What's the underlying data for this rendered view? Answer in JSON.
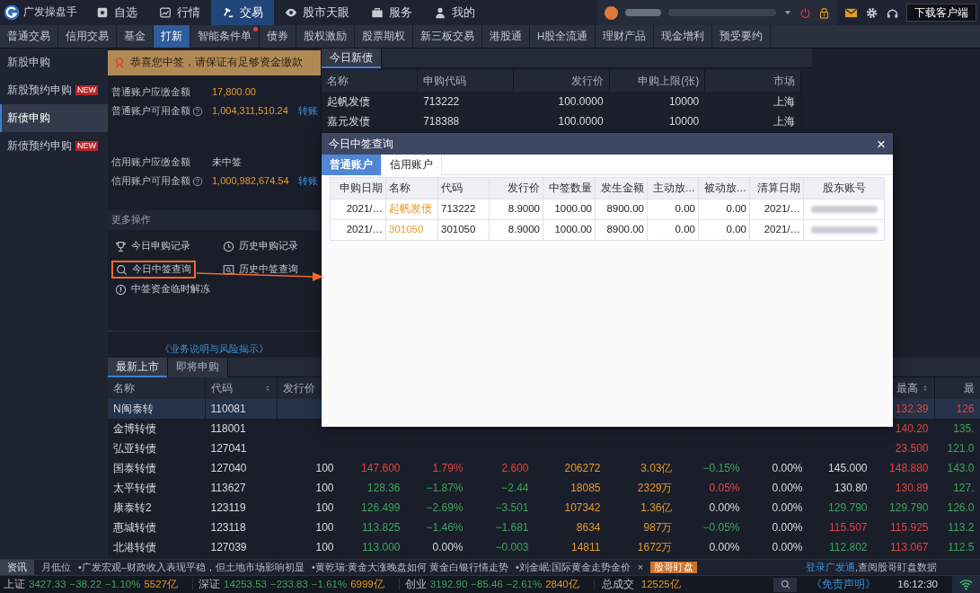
{
  "top_nav": {
    "logo": "广发操盘手",
    "items": [
      {
        "label": "自选",
        "selected": false
      },
      {
        "label": "行情",
        "selected": false
      },
      {
        "label": "交易",
        "selected": true
      },
      {
        "label": "股市天眼",
        "selected": false
      },
      {
        "label": "服务",
        "selected": false
      },
      {
        "label": "我的",
        "selected": false
      }
    ],
    "download": "下载客户端"
  },
  "sub_nav": [
    {
      "label": "普通交易",
      "selected": false
    },
    {
      "label": "信用交易",
      "selected": false
    },
    {
      "label": "基金",
      "selected": false
    },
    {
      "label": "打新",
      "selected": true
    },
    {
      "label": "智能条件单",
      "selected": false,
      "dot": true
    },
    {
      "label": "债券",
      "selected": false
    },
    {
      "label": "股权激励",
      "selected": false
    },
    {
      "label": "股票期权",
      "selected": false
    },
    {
      "label": "新三板交易",
      "selected": false
    },
    {
      "label": "港股通",
      "selected": false
    },
    {
      "label": "H股全流通",
      "selected": false
    },
    {
      "label": "理财产品",
      "selected": false
    },
    {
      "label": "现金增利",
      "selected": false
    },
    {
      "label": "预受要约",
      "selected": false
    }
  ],
  "sidebar": {
    "items": [
      {
        "label": "新股申购",
        "selected": false
      },
      {
        "label": "新股预约申购",
        "selected": false,
        "badge": "NEW"
      },
      {
        "label": "新债申购",
        "selected": true
      },
      {
        "label": "新债预约申购",
        "selected": false,
        "badge": "NEW"
      }
    ]
  },
  "notice": "恭喜您中签，请保证有足够资金缴款",
  "accounts": [
    {
      "rows": [
        {
          "label": "普通账户应缴金额",
          "value": "17,800.00",
          "color": "#e39a2c"
        },
        {
          "label": "普通账户可用金额",
          "help": true,
          "value": "1,004,311,510.24",
          "color": "#e39a2c",
          "link": "转账"
        }
      ]
    },
    {
      "rows": [
        {
          "label": "信用账户应缴金额",
          "value": "未中签"
        },
        {
          "label": "信用账户可用金额",
          "help": true,
          "value": "1,000,982,674.54",
          "color": "#e39a2c",
          "link": "转账"
        }
      ]
    }
  ],
  "more_actions": {
    "title": "更多操作",
    "actions": [
      {
        "label": "今日申购记录",
        "highlighted": false
      },
      {
        "label": "历史申购记录",
        "highlighted": false
      },
      {
        "label": "今日中签查询",
        "highlighted": true
      },
      {
        "label": "历史中签查询",
        "highlighted": false
      },
      {
        "label": "中签资金临时解冻",
        "highlighted": false
      }
    ]
  },
  "risk_link": "《业务说明与风险揭示》",
  "new_bonds": {
    "tab": "今日新债",
    "columns": [
      "名称",
      "申购代码",
      "发行价",
      "申购上限(张)",
      "市场"
    ],
    "rows": [
      [
        "起帆发债",
        "713222",
        "100.0000",
        "10000",
        "上海"
      ],
      [
        "嘉元发债",
        "718388",
        "100.0000",
        "10000",
        "上海"
      ]
    ]
  },
  "dialog": {
    "title": "今日中签查询",
    "close": "×",
    "tabs": [
      {
        "label": "普通账户",
        "selected": true
      },
      {
        "label": "信用账户",
        "selected": false
      }
    ],
    "columns": [
      "申购日期",
      "名称",
      "代码",
      "发行价",
      "中签数量",
      "发生金额",
      "主动放…",
      "被动放…",
      "清算日期",
      "股东账号"
    ],
    "rows": [
      {
        "cells": [
          "2021/…",
          "起帆发债",
          "713222",
          "8.9000",
          "1000.00",
          "8900.00",
          "0.00",
          "0.00",
          "2021/…"
        ],
        "account_hidden": true
      },
      {
        "cells": [
          "2021/…",
          "301050",
          "301050",
          "8.9000",
          "1000.00",
          "8900.00",
          "0.00",
          "0.00",
          "2021/…"
        ],
        "account_hidden": true
      }
    ]
  },
  "listing": {
    "tabs": [
      {
        "label": "最新上市",
        "selected": true
      },
      {
        "label": "即将申购",
        "selected": false
      }
    ],
    "columns": [
      {
        "label": "名称"
      },
      {
        "label": "代码",
        "sortable": true
      },
      {
        "label": "发行价"
      },
      {},
      {},
      {},
      {},
      {},
      {},
      {},
      {},
      {
        "label": "最高",
        "sortable": true
      },
      {
        "label": "最"
      }
    ],
    "rows": [
      {
        "selected": true,
        "cells": [
          {
            "text": "N闽泰转"
          },
          {
            "text": "110081"
          },
          null,
          null,
          null,
          null,
          null,
          null,
          null,
          null,
          null,
          {
            "text": "132.39",
            "color": "#e2433f"
          },
          {
            "text": "126",
            "color": "#e2433f"
          }
        ]
      },
      {
        "selected": false,
        "cells": [
          {
            "text": "金博转债"
          },
          {
            "text": "118001"
          },
          null,
          null,
          null,
          null,
          null,
          null,
          null,
          null,
          null,
          {
            "text": "140.20",
            "color": "#e2433f"
          },
          {
            "text": "135.",
            "color": "#3ba55c"
          }
        ]
      },
      {
        "selected": false,
        "cells": [
          {
            "text": "弘亚转债"
          },
          {
            "text": "127041"
          },
          null,
          null,
          null,
          null,
          null,
          null,
          null,
          null,
          null,
          {
            "text": "23.500",
            "color": "#e2433f"
          },
          {
            "text": "121.0",
            "color": "#3ba55c"
          }
        ]
      },
      {
        "selected": false,
        "cells": [
          {
            "text": "国泰转债"
          },
          {
            "text": "127040"
          },
          {
            "text": "100",
            "color": "#d9dbe0"
          },
          {
            "text": "147.600",
            "color": "#e2433f"
          },
          {
            "text": "1.79%",
            "color": "#e2433f"
          },
          {
            "text": "2.600",
            "color": "#e2433f"
          },
          {
            "text": "206272",
            "color": "#e39a2c"
          },
          {
            "text": "3.03亿",
            "color": "#e39a2c"
          },
          {
            "text": "−0.15%",
            "color": "#3ba55c"
          },
          {
            "text": "0.00%",
            "color": "#d9dbe0"
          },
          {
            "text": "145.000",
            "color": "#d9dbe0"
          },
          {
            "text": "148.880",
            "color": "#e2433f"
          },
          {
            "text": "143.0",
            "color": "#3ba55c"
          }
        ]
      },
      {
        "selected": false,
        "cells": [
          {
            "text": "太平转债"
          },
          {
            "text": "113627"
          },
          {
            "text": "100",
            "color": "#d9dbe0"
          },
          {
            "text": "128.36",
            "color": "#3ba55c"
          },
          {
            "text": "−1.87%",
            "color": "#3ba55c"
          },
          {
            "text": "−2.44",
            "color": "#3ba55c"
          },
          {
            "text": "18085",
            "color": "#e39a2c"
          },
          {
            "text": "2329万",
            "color": "#e39a2c"
          },
          {
            "text": "0.05%",
            "color": "#e2433f"
          },
          {
            "text": "0.00%",
            "color": "#d9dbe0"
          },
          {
            "text": "130.80",
            "color": "#d9dbe0"
          },
          {
            "text": "130.89",
            "color": "#e2433f"
          },
          {
            "text": "127.",
            "color": "#3ba55c"
          }
        ]
      },
      {
        "selected": false,
        "cells": [
          {
            "text": "康泰转2"
          },
          {
            "text": "123119"
          },
          {
            "text": "100",
            "color": "#d9dbe0"
          },
          {
            "text": "126.499",
            "color": "#3ba55c"
          },
          {
            "text": "−2.69%",
            "color": "#3ba55c"
          },
          {
            "text": "−3.501",
            "color": "#3ba55c"
          },
          {
            "text": "107342",
            "color": "#e39a2c"
          },
          {
            "text": "1.36亿",
            "color": "#e39a2c"
          },
          {
            "text": "0.00%",
            "color": "#d9dbe0"
          },
          {
            "text": "0.00%",
            "color": "#d9dbe0"
          },
          {
            "text": "129.790",
            "color": "#3ba55c"
          },
          {
            "text": "129.790",
            "color": "#3ba55c"
          },
          {
            "text": "126.0",
            "color": "#3ba55c"
          }
        ]
      },
      {
        "selected": false,
        "cells": [
          {
            "text": "惠城转债"
          },
          {
            "text": "123118"
          },
          {
            "text": "100",
            "color": "#d9dbe0"
          },
          {
            "text": "113.825",
            "color": "#3ba55c"
          },
          {
            "text": "−1.46%",
            "color": "#3ba55c"
          },
          {
            "text": "−1.681",
            "color": "#3ba55c"
          },
          {
            "text": "8634",
            "color": "#e39a2c"
          },
          {
            "text": "987万",
            "color": "#e39a2c"
          },
          {
            "text": "−0.05%",
            "color": "#3ba55c"
          },
          {
            "text": "0.00%",
            "color": "#d9dbe0"
          },
          {
            "text": "115.507",
            "color": "#e2433f"
          },
          {
            "text": "115.925",
            "color": "#e2433f"
          },
          {
            "text": "113.2",
            "color": "#3ba55c"
          }
        ]
      },
      {
        "selected": false,
        "cells": [
          {
            "text": "北港转债"
          },
          {
            "text": "127039"
          },
          {
            "text": "100",
            "color": "#d9dbe0"
          },
          {
            "text": "113.000",
            "color": "#3ba55c"
          },
          {
            "text": "0.00%",
            "color": "#d9dbe0"
          },
          {
            "text": "−0.003",
            "color": "#3ba55c"
          },
          {
            "text": "14811",
            "color": "#e39a2c"
          },
          {
            "text": "1672万",
            "color": "#e39a2c"
          },
          {
            "text": "0.00%",
            "color": "#d9dbe0"
          },
          {
            "text": "0.00%",
            "color": "#d9dbe0"
          },
          {
            "text": "112.802",
            "color": "#3ba55c"
          },
          {
            "text": "113.067",
            "color": "#e2433f"
          },
          {
            "text": "112.5",
            "color": "#3ba55c"
          }
        ]
      }
    ]
  },
  "news": {
    "tab": "资讯",
    "items": [
      "月低位",
      "•广发宏观–财政收入表现平稳，但土地市场影响初显",
      "•黄乾瑞:黄金大涨晚盘如何 黄金白银行情走势",
      "•刘金岷:国际黄金走势金价"
    ],
    "close": "×",
    "promo": "股哥盯盘",
    "login_link": "登录广发通",
    "login_text": ",查阅股哥盯盘数据"
  },
  "status_bar": {
    "indices": [
      {
        "name": "上证",
        "value": "3427.33",
        "change": "−38.22",
        "pct": "−1.10%",
        "volume": "5527亿",
        "color": "#3ba55c"
      },
      {
        "name": "深证",
        "value": "14253.53",
        "change": "−233.83",
        "pct": "−1.61%",
        "volume": "6999亿",
        "color": "#3ba55c"
      },
      {
        "name": "创业",
        "value": "3192.90",
        "change": "−85.46",
        "pct": "−2.61%",
        "volume": "2840亿",
        "color": "#3ba55c"
      }
    ],
    "turnover_label": "总成交",
    "turnover": "12525亿",
    "disclaimer": "《免责声明》",
    "time": "16:12:30"
  }
}
